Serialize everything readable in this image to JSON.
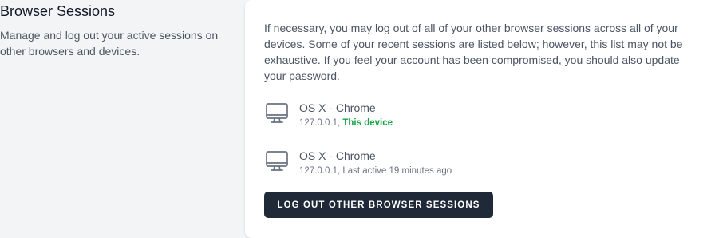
{
  "section": {
    "title": "Browser Sessions",
    "description": "Manage and log out your active sessions on other browsers and devices."
  },
  "card": {
    "intro": "If necessary, you may log out of all of your other browser sessions across all of your devices. Some of your recent sessions are listed below; however, this list may not be exhaustive. If you feel your account has been compromised, you should also update your password."
  },
  "sessions": [
    {
      "icon": "desktop-icon",
      "platform": "OS X - Chrome",
      "ip_prefix": "127.0.0.1, ",
      "status": "This device"
    },
    {
      "icon": "desktop-icon",
      "platform": "OS X - Chrome",
      "ip_prefix": "127.0.0.1, ",
      "status": "Last active 19 minutes ago"
    }
  ],
  "actions": {
    "logout_label": "Log Out Other Browser Sessions"
  },
  "colors": {
    "current_device": "#16a34a",
    "button_bg": "#1f2937"
  }
}
